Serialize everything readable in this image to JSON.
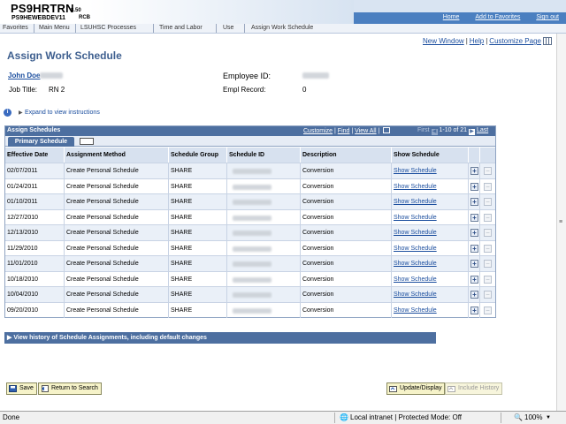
{
  "banner": {
    "database": "PS9HRTRN",
    "version": "8.50",
    "server": "PS9HEWEBDEV11",
    "user_code": "RCB",
    "links": [
      "Home",
      "Add to Favorites",
      "Sign out"
    ]
  },
  "menubar": {
    "items": [
      "Favorites",
      "Main Menu",
      "LSUHSC Processes",
      "Time and Labor",
      "Use",
      "Assign Work Schedule"
    ]
  },
  "header_links": {
    "new_window": "New Window",
    "help": "Help",
    "customize_page": "Customize Page"
  },
  "page_title": "Assign Work Schedule",
  "employee": {
    "name": "John Doe",
    "job_title_label": "Job Title:",
    "job_title": "RN 2",
    "employee_id_label": "Employee ID:",
    "empl_record_label": "Empl Record:",
    "empl_record": "0"
  },
  "instructions_link": "Expand to view instructions",
  "grid": {
    "title": "Assign Schedules",
    "controls": [
      "Customize",
      "Find",
      "View All"
    ],
    "nav_first": "First",
    "nav_range": "1-10 of 21",
    "nav_last": "Last",
    "tab_label": "Primary Schedule",
    "columns": [
      "Effective Date",
      "Assignment Method",
      "Schedule Group",
      "Schedule ID",
      "Description",
      "Show Schedule"
    ],
    "rows": [
      {
        "date": "02/07/2011",
        "method": "Create Personal Schedule",
        "group": "SHARE",
        "description": "Conversion",
        "link": "Show Schedule"
      },
      {
        "date": "01/24/2011",
        "method": "Create Personal Schedule",
        "group": "SHARE",
        "description": "Conversion",
        "link": "Show Schedule"
      },
      {
        "date": "01/10/2011",
        "method": "Create Personal Schedule",
        "group": "SHARE",
        "description": "Conversion",
        "link": "Show Schedule"
      },
      {
        "date": "12/27/2010",
        "method": "Create Personal Schedule",
        "group": "SHARE",
        "description": "Conversion",
        "link": "Show Schedule"
      },
      {
        "date": "12/13/2010",
        "method": "Create Personal Schedule",
        "group": "SHARE",
        "description": "Conversion",
        "link": "Show Schedule"
      },
      {
        "date": "11/29/2010",
        "method": "Create Personal Schedule",
        "group": "SHARE",
        "description": "Conversion",
        "link": "Show Schedule"
      },
      {
        "date": "11/01/2010",
        "method": "Create Personal Schedule",
        "group": "SHARE",
        "description": "Conversion",
        "link": "Show Schedule"
      },
      {
        "date": "10/18/2010",
        "method": "Create Personal Schedule",
        "group": "SHARE",
        "description": "Conversion",
        "link": "Show Schedule"
      },
      {
        "date": "10/04/2010",
        "method": "Create Personal Schedule",
        "group": "SHARE",
        "description": "Conversion",
        "link": "Show Schedule"
      },
      {
        "date": "09/20/2010",
        "method": "Create Personal Schedule",
        "group": "SHARE",
        "description": "Conversion",
        "link": "Show Schedule"
      }
    ]
  },
  "history_bar": "View history of Schedule Assignments, including default changes",
  "buttons": {
    "save": "Save",
    "return_to_search": "Return to Search",
    "update_display": "Update/Display",
    "include_history": "Include History"
  },
  "statusbar": {
    "left": "Done",
    "zone": "Local intranet | Protected Mode: Off",
    "zoom": "100%"
  },
  "colors": {
    "header_blue": "#4d6fa0",
    "link_blue": "#1a4d9e",
    "title_blue": "#3e5f8f"
  }
}
